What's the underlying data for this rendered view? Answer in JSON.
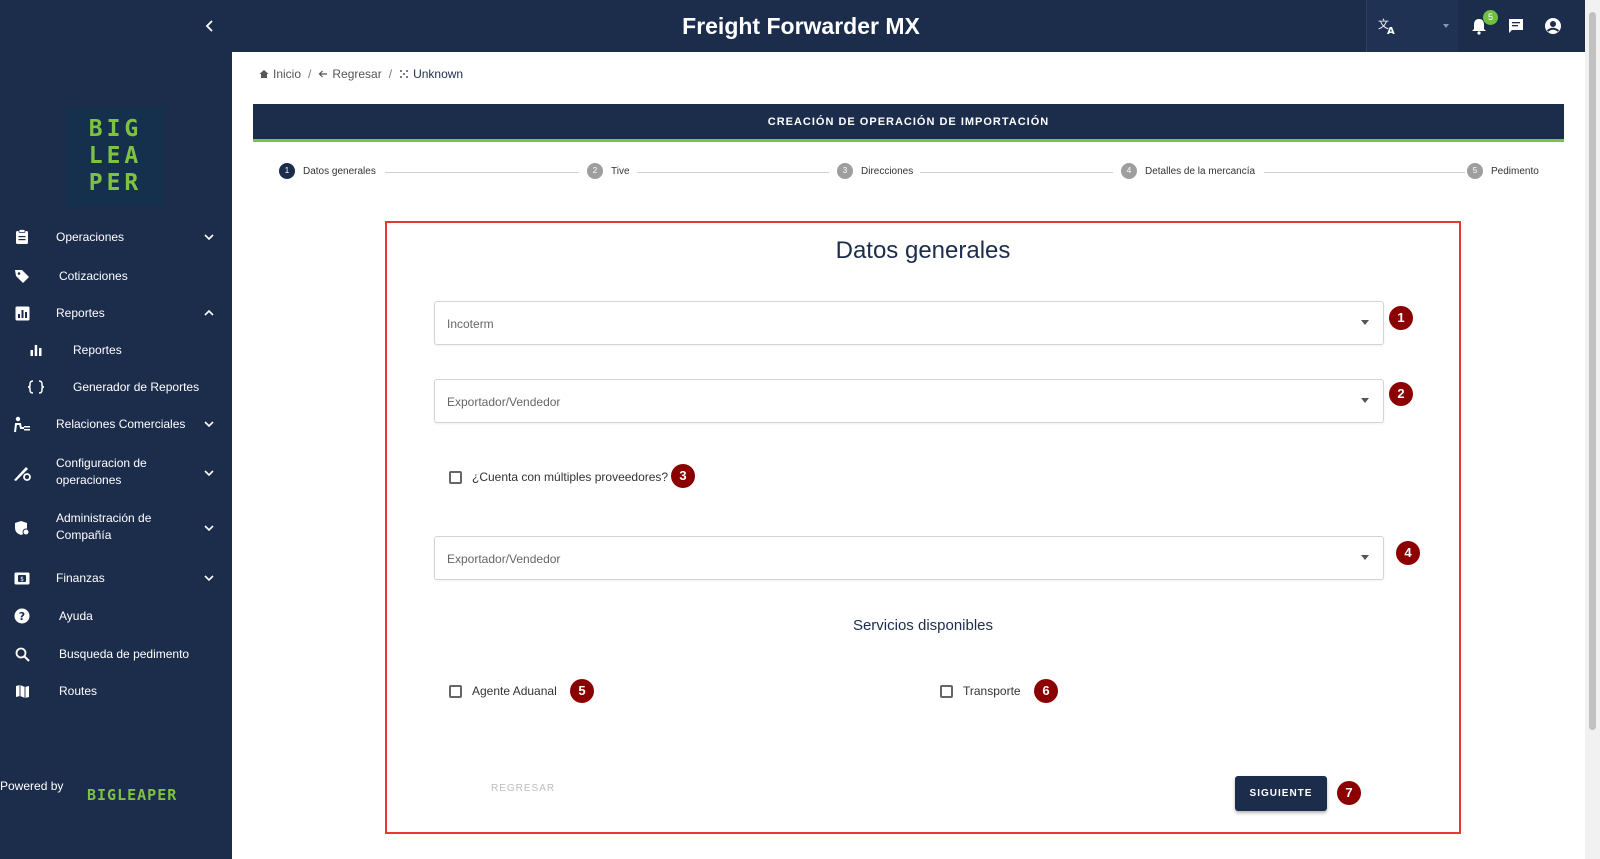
{
  "app": {
    "title": "Freight Forwarder MX",
    "notification_count": "5"
  },
  "logo": {
    "lines": [
      "BIG",
      "LEA",
      "PER"
    ]
  },
  "sidebar": {
    "items": [
      {
        "label": "Operaciones",
        "icon": "clipboard-icon",
        "chevron": "down"
      },
      {
        "label": "Cotizaciones",
        "icon": "tag-icon"
      },
      {
        "label": "Reportes",
        "icon": "report-icon",
        "chevron": "up"
      },
      {
        "label": "Reportes",
        "icon": "bar-chart-icon",
        "sub": true
      },
      {
        "label": "Generador de Reportes",
        "icon": "braces-icon",
        "sub": true
      },
      {
        "label": "Relaciones Comerciales",
        "icon": "people-icon",
        "chevron": "down"
      },
      {
        "label": "Configuracion de operaciones",
        "icon": "config-icon",
        "chevron": "down"
      },
      {
        "label": "Administración de Compañía",
        "icon": "admin-icon",
        "chevron": "down"
      },
      {
        "label": "Finanzas",
        "icon": "money-icon",
        "chevron": "down"
      },
      {
        "label": "Ayuda",
        "icon": "help-icon"
      },
      {
        "label": "Busqueda de pedimento",
        "icon": "search-icon"
      },
      {
        "label": "Routes",
        "icon": "map-icon"
      }
    ],
    "powered_by": "Powered by",
    "powered_logo": "BIGLEAPER"
  },
  "breadcrumb": {
    "home": "Inicio",
    "back": "Regresar",
    "current": "Unknown"
  },
  "banner": {
    "title": "CREACIÓN DE OPERACIÓN DE IMPORTACIÓN"
  },
  "stepper": {
    "steps": [
      {
        "num": "1",
        "label": "Datos generales"
      },
      {
        "num": "2",
        "label": "Tive"
      },
      {
        "num": "3",
        "label": "Direcciones"
      },
      {
        "num": "4",
        "label": "Detalles de la mercancía"
      },
      {
        "num": "5",
        "label": "Pedimento"
      }
    ]
  },
  "form": {
    "title": "Datos generales",
    "incoterm_placeholder": "Incoterm",
    "exporter_placeholder": "Exportador/Vendedor",
    "multiple_suppliers_label": "¿Cuenta con múltiples proveedores?",
    "exporter2_placeholder": "Exportador/Vendedor",
    "services_title": "Servicios disponibles",
    "customs_agent_label": "Agente Aduanal",
    "transport_label": "Transporte",
    "back_button": "REGRESAR",
    "next_button": "SIGUIENTE"
  },
  "markers": [
    "1",
    "2",
    "3",
    "4",
    "5",
    "6",
    "7"
  ],
  "colors": {
    "navy": "#1c2d4c",
    "accent_green": "#7ec242",
    "marker_red": "#8b0000",
    "frame_red": "#e53935"
  }
}
